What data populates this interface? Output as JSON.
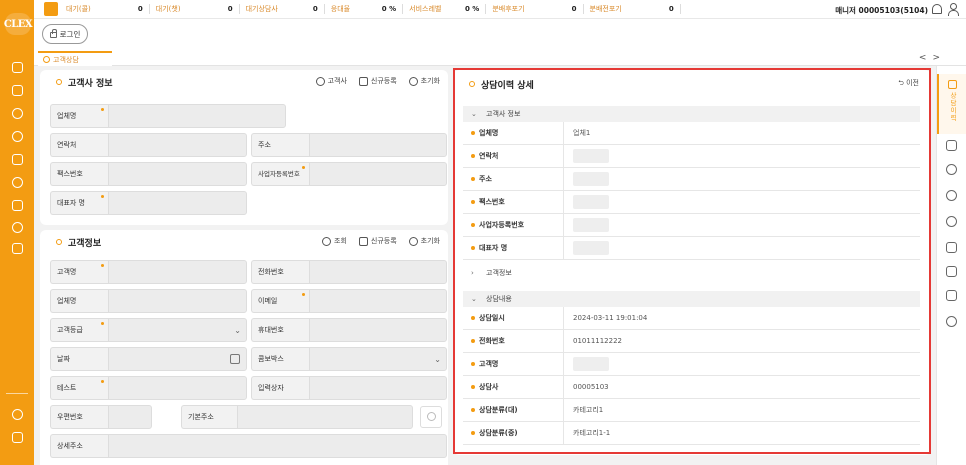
{
  "sidebar": {
    "logo": "CLEX",
    "icons": [
      "headset-icon",
      "clipboard-icon",
      "chat-icon",
      "refresh-icon",
      "message-icon",
      "support-icon",
      "report-icon",
      "clock-icon",
      "document-icon",
      "settings-icon",
      "logout-icon"
    ]
  },
  "topbar": {
    "stats": [
      {
        "label": "대기(콜)",
        "value": "0"
      },
      {
        "label": "대기(챗)",
        "value": "0"
      },
      {
        "label": "대기상담사",
        "value": "0"
      },
      {
        "label": "응대율",
        "value": "0 %"
      },
      {
        "label": "서비스레벨",
        "value": "0 %"
      },
      {
        "label": "분배후포기",
        "value": "0"
      },
      {
        "label": "분배전포기",
        "value": "0"
      }
    ],
    "manager": "매니저 00005103(5104)"
  },
  "login_button": "로그인",
  "tab": {
    "label": "고객상담"
  },
  "nav": {
    "prev": "<",
    "next": ">"
  },
  "company_panel": {
    "title": "고객사 정보",
    "actions": [
      "고객사",
      "신규등록",
      "초기화"
    ],
    "fields": {
      "company": "업체명",
      "contact": "연락처",
      "address": "주소",
      "fax": "팩스번호",
      "bizno": "사업자등록번호",
      "ceo": "대표자 명"
    }
  },
  "customer_panel": {
    "title": "고객정보",
    "actions": [
      "조회",
      "신규등록",
      "초기화"
    ],
    "fields": {
      "name": "고객명",
      "phone": "전화번호",
      "company": "업체명",
      "email": "이메일",
      "grade": "고객등급",
      "mobile": "휴대번호",
      "date": "날짜",
      "combo": "콤보박스",
      "test": "테스트",
      "writer": "입력상자",
      "zip": "우편번호",
      "base_addr": "기본주소",
      "detail_addr": "상세주소"
    }
  },
  "detail": {
    "title": "상담이력 상세",
    "back": "이전",
    "sections": {
      "company": "고객사 정보",
      "customer": "고객정보",
      "consult": "상담내용"
    },
    "company_rows": [
      {
        "label": "업체명",
        "value": "업체1"
      },
      {
        "label": "연락처",
        "value": ""
      },
      {
        "label": "주소",
        "value": ""
      },
      {
        "label": "팩스번호",
        "value": ""
      },
      {
        "label": "사업자등록번호",
        "value": ""
      },
      {
        "label": "대표자 명",
        "value": ""
      }
    ],
    "consult_rows": [
      {
        "label": "상담일시",
        "value": "2024-03-11 19:01:04"
      },
      {
        "label": "전화번호",
        "value": "01011112222"
      },
      {
        "label": "고객명",
        "value": ""
      },
      {
        "label": "상담사",
        "value": "00005103"
      },
      {
        "label": "상담분류(대)",
        "value": "카테고리1"
      },
      {
        "label": "상담분류(중)",
        "value": "카테고리1-1"
      }
    ]
  },
  "right_sidebar": {
    "active_label": "상담이력"
  }
}
